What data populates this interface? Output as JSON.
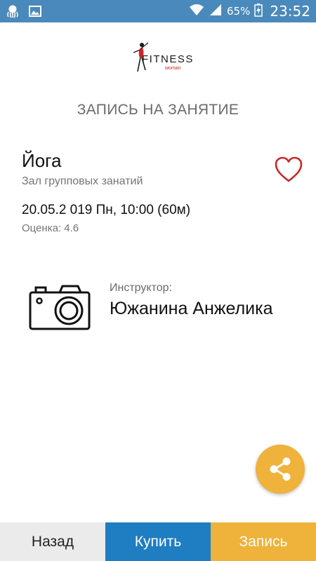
{
  "status_bar": {
    "battery_percent": "65%",
    "time": "23:52",
    "background": "#4a89bb",
    "icons": [
      "octopus-icon",
      "image-icon",
      "wifi-icon",
      "signal-icon",
      "battery-charging-icon"
    ]
  },
  "logo": {
    "text": "FITNESS",
    "sub": "woman",
    "accent": "#d2232a"
  },
  "page": {
    "title": "ЗАПИСЬ НА ЗАНЯТИЕ"
  },
  "class_info": {
    "name": "Йога",
    "hall": "Зал групповых занатий",
    "datetime": "20.05.2 019 Пн, 10:00 (60м)",
    "rating": "Оценка: 4.6",
    "favorite_icon": "heart-outline-icon",
    "favorite_color": "#c62828"
  },
  "instructor": {
    "label": "Инструктор:",
    "name": "Южанина Анжелика",
    "photo_icon": "camera-icon"
  },
  "fab": {
    "icon": "share-icon",
    "color": "#efb23a"
  },
  "bottom_bar": {
    "back_label": "Назад",
    "buy_label": "Купить",
    "book_label": "Запись",
    "back_color": "#ebebeb",
    "buy_color": "#1f7dc1",
    "book_color": "#efb23a"
  }
}
